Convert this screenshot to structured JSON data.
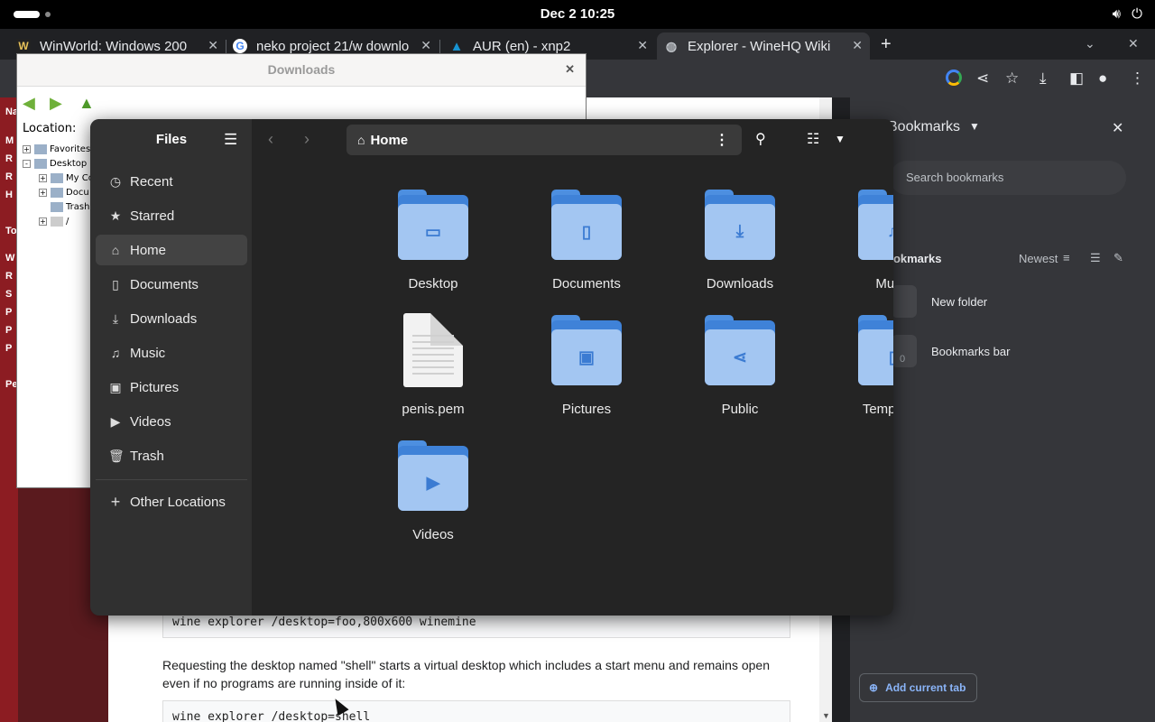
{
  "topbar": {
    "clock": "Dec 2  10:25"
  },
  "browser": {
    "tabs": [
      {
        "label": "WinWorld: Windows 200",
        "favicon": "W"
      },
      {
        "label": "neko project 21/w downlo",
        "favicon": "G"
      },
      {
        "label": "AUR (en) - xnp2",
        "favicon": "A"
      },
      {
        "label": "Explorer - WineHQ Wiki",
        "favicon": "globe"
      }
    ],
    "page": {
      "code1": "wine explorer /desktop=foo,800x600 winemine",
      "paragraph": "Requesting the desktop named \"shell\" starts a virtual desktop which includes a start menu and remains open even if no programs are running inside of it:",
      "code2": "wine explorer /desktop=shell",
      "left_letters": [
        "Na",
        "M",
        "R",
        "R",
        "H",
        "To",
        "W",
        "R",
        "S",
        "P",
        "P",
        "P",
        "Pe"
      ]
    },
    "bookmarks_panel": {
      "title": "Bookmarks",
      "search_placeholder": "Search bookmarks",
      "section_label": "ookmarks",
      "sort_label": "Newest",
      "items": [
        {
          "label": "New folder",
          "count": ""
        },
        {
          "label": "Bookmarks bar",
          "count": "0"
        }
      ],
      "add_button": "Add current tab"
    }
  },
  "wine_window": {
    "title": "Downloads",
    "location_label": "Location:",
    "tree": [
      {
        "label": "Favorites",
        "expander": "+"
      },
      {
        "label": "Desktop",
        "expander": "-"
      },
      {
        "label": "My Co",
        "expander": "+"
      },
      {
        "label": "Docu",
        "expander": "+"
      },
      {
        "label": "Trash",
        "expander": ""
      },
      {
        "label": "/",
        "expander": "+"
      }
    ]
  },
  "files": {
    "sidebar_title": "Files",
    "sidebar_items": [
      {
        "label": "Recent",
        "icon": "clock-icon"
      },
      {
        "label": "Starred",
        "icon": "star-icon"
      },
      {
        "label": "Home",
        "icon": "home-icon"
      },
      {
        "label": "Documents",
        "icon": "document-icon"
      },
      {
        "label": "Downloads",
        "icon": "download-icon"
      },
      {
        "label": "Music",
        "icon": "music-icon"
      },
      {
        "label": "Pictures",
        "icon": "picture-icon"
      },
      {
        "label": "Videos",
        "icon": "video-icon"
      },
      {
        "label": "Trash",
        "icon": "trash-icon"
      }
    ],
    "other_locations": "Other Locations",
    "path_label": "Home",
    "items": [
      {
        "label": "Desktop",
        "type": "folder",
        "glyph": "▭"
      },
      {
        "label": "Documents",
        "type": "folder",
        "glyph": "▯"
      },
      {
        "label": "Downloads",
        "type": "folder",
        "glyph": "⤓"
      },
      {
        "label": "Music",
        "type": "folder",
        "glyph": "♫"
      },
      {
        "label": "penis.pem",
        "type": "file",
        "glyph": ""
      },
      {
        "label": "Pictures",
        "type": "folder",
        "glyph": "▣"
      },
      {
        "label": "Public",
        "type": "folder",
        "glyph": "⋖"
      },
      {
        "label": "Templates",
        "type": "folder",
        "glyph": "▯"
      },
      {
        "label": "Videos",
        "type": "folder",
        "glyph": "▶"
      }
    ]
  }
}
